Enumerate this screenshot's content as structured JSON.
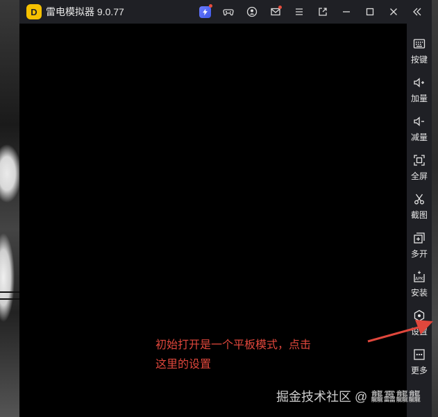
{
  "app": {
    "title": "雷电模拟器 9.0.77",
    "logo_letter": "D",
    "accent_color": "#f5c000"
  },
  "titlebar_icons": [
    {
      "icon": "bolt-icon",
      "badge": true
    },
    {
      "icon": "gamepad-icon",
      "badge": false
    },
    {
      "icon": "user-icon",
      "badge": false
    },
    {
      "icon": "mail-icon",
      "badge": true
    },
    {
      "icon": "menu-icon",
      "badge": false
    },
    {
      "icon": "sync-window-icon",
      "badge": false
    },
    {
      "icon": "minimize-icon",
      "badge": false
    },
    {
      "icon": "maximize-icon",
      "badge": false
    },
    {
      "icon": "close-icon",
      "badge": false
    },
    {
      "icon": "collapse-sidebar-icon",
      "badge": false
    }
  ],
  "sidebar": {
    "items": [
      {
        "label": "按键",
        "icon": "keyboard-icon"
      },
      {
        "label": "加量",
        "icon": "volume-up-icon"
      },
      {
        "label": "减量",
        "icon": "volume-down-icon"
      },
      {
        "label": "全屏",
        "icon": "fullscreen-icon"
      },
      {
        "label": "截图",
        "icon": "scissors-icon"
      },
      {
        "label": "多开",
        "icon": "multi-instance-icon"
      },
      {
        "label": "安装",
        "icon": "apk-install-icon"
      },
      {
        "label": "设置",
        "icon": "settings-icon"
      },
      {
        "label": "更多",
        "icon": "more-icon"
      }
    ]
  },
  "annotation": {
    "line1": "初始打开是一个平板模式，点击",
    "line2": "这里的设置",
    "color": "#e0473c"
  },
  "watermark": "掘金技术社区 @ 龘靐龘龘"
}
